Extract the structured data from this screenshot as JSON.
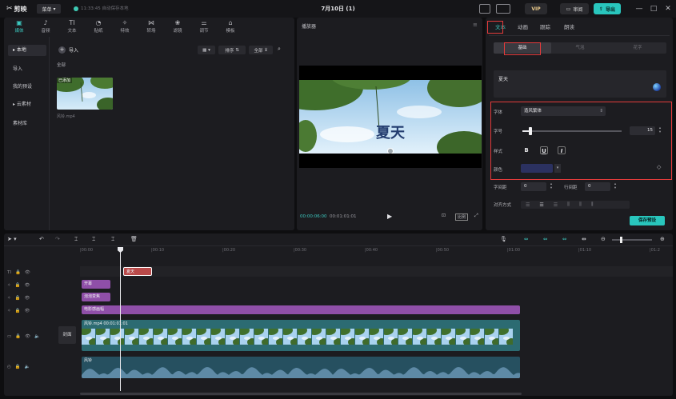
{
  "app": {
    "name": "剪映",
    "menu_label": "菜单",
    "autosave": "11:33:45 自动保存本地",
    "project_title": "7月10日 (1)",
    "vip_label": "VIP",
    "review_label": "审阅",
    "export_label": "导出",
    "win_min": "—",
    "win_max": "□",
    "win_close": "✕"
  },
  "toolbar_tabs": [
    {
      "label": "媒体",
      "icon": "media-icon",
      "glyph": "▣"
    },
    {
      "label": "音频",
      "icon": "audio-icon",
      "glyph": "♪"
    },
    {
      "label": "文本",
      "icon": "text-icon",
      "glyph": "TI"
    },
    {
      "label": "贴纸",
      "icon": "sticker-icon",
      "glyph": "◔"
    },
    {
      "label": "特效",
      "icon": "effects-icon",
      "glyph": "✧"
    },
    {
      "label": "转场",
      "icon": "transition-icon",
      "glyph": "⋈"
    },
    {
      "label": "滤镜",
      "icon": "filter-icon",
      "glyph": "❀"
    },
    {
      "label": "调节",
      "icon": "adjust-icon",
      "glyph": "⚌"
    },
    {
      "label": "模板",
      "icon": "template-icon",
      "glyph": "⌂"
    }
  ],
  "side_nav": [
    {
      "label": "▸ 本地"
    },
    {
      "label": "导入"
    },
    {
      "label": "我的预设"
    },
    {
      "label": "▸ 云素材"
    },
    {
      "label": "素材库"
    }
  ],
  "media": {
    "import_label": "导入",
    "sort_label": "排序",
    "filter_label": "全部",
    "all_label": "全部",
    "added_tag": "已添加",
    "file_name": "风铃.mp4"
  },
  "player": {
    "title": "播放器",
    "overlay_text": "夏天",
    "time_current": "00:00:06:00",
    "time_total": "00:01:01:01",
    "ratio_label": "比例"
  },
  "inspector": {
    "tabs": [
      "文本",
      "动画",
      "跟踪",
      "朗读"
    ],
    "sub_tabs": [
      "基础",
      "气泡",
      "花字"
    ],
    "text_content": "夏天",
    "font_label": "字体",
    "font_value": "造风繁体",
    "size_label": "字号",
    "size_value": "15",
    "size_fraction": 0.08,
    "style_label": "样式",
    "style_bold": "B",
    "style_underline": "U",
    "style_italic": "I",
    "color_label": "颜色",
    "color_value": "#2b3160",
    "letter_spacing_label": "字间距",
    "letter_spacing_value": "0",
    "line_spacing_label": "行间距",
    "line_spacing_value": "0",
    "align_label": "对齐方式",
    "save_preset_label": "保存预设"
  },
  "timeline": {
    "ruler": [
      "|00:00",
      "|00:10",
      "|00:20",
      "|00:30",
      "|00:40",
      "|00:50",
      "|01:00",
      "|01:10",
      "|01:2"
    ],
    "tracks": {
      "text_clip": "夏天",
      "effects": [
        "开幕",
        "泡泡变焦",
        "电影感画幅"
      ],
      "video_clip": "风铃.mp4  00:01:01:01",
      "audio_clip": "风铃"
    },
    "cover_label": "封面"
  },
  "colors": {
    "accent": "#29c6bd",
    "highlight": "#e33b3b",
    "effect_clip": "#8f4fa8",
    "video_clip": "#2c6b72"
  }
}
